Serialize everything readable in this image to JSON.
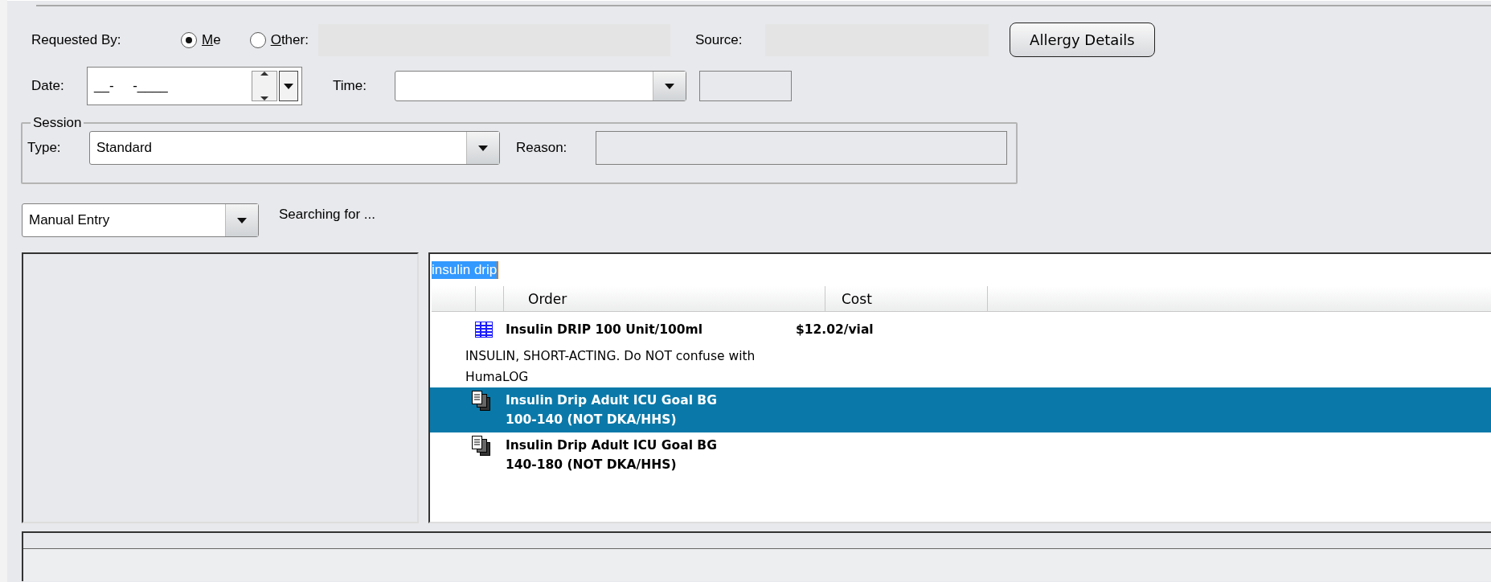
{
  "requested_by": {
    "label": "Requested By:",
    "options": [
      {
        "label": "Me",
        "selected": true
      },
      {
        "label": "Other:",
        "selected": false
      }
    ]
  },
  "source": {
    "label": "Source:"
  },
  "allergy_button": "Allergy Details",
  "date": {
    "label": "Date:",
    "value": "__-     -____"
  },
  "time": {
    "label": "Time:"
  },
  "session": {
    "title": "Session",
    "type": {
      "label": "Type:",
      "value": "Standard"
    },
    "reason": {
      "label": "Reason:"
    }
  },
  "search_mode": {
    "value": "Manual Entry"
  },
  "search_status": "Searching for ...",
  "search": {
    "value": "insulin drip"
  },
  "results": {
    "columns": [
      "Order",
      "Cost"
    ],
    "rows": [
      {
        "kind": "order",
        "name": "Insulin DRIP 100 Unit/100ml",
        "cost": "$12.02/vial",
        "selected": false
      },
      {
        "kind": "note",
        "text": "INSULIN, SHORT-ACTING.  Do NOT confuse with\nHumaLOG"
      },
      {
        "kind": "careset",
        "name": "Insulin Drip Adult ICU Goal BG\n100-140 (NOT DKA/HHS)",
        "selected": true
      },
      {
        "kind": "careset",
        "name": "Insulin Drip Adult ICU Goal BG\n140-180 (NOT DKA/HHS)",
        "selected": false
      }
    ]
  }
}
